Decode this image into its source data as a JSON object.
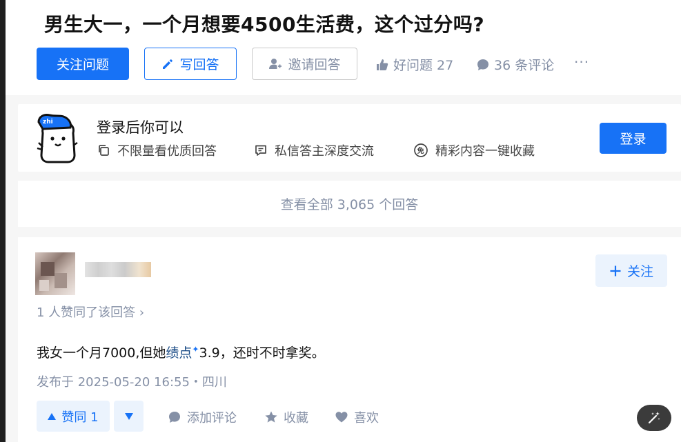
{
  "question": {
    "title": "男生大一，一个月想要4500生活费，这个过分吗?",
    "follow_label": "关注问题",
    "write_label": "写回答",
    "invite_label": "邀请回答",
    "good_question_label": "好问题 27",
    "comments_label": "36 条评论",
    "more_label": "···"
  },
  "login_prompt": {
    "title": "登录后你可以",
    "benefits": [
      "不限量看优质回答",
      "私信答主深度交流",
      "精彩内容一键收藏"
    ],
    "login_label": "登录"
  },
  "view_all_label": "查看全部 3,065 个回答",
  "answer": {
    "follow_label": "关注",
    "voters_label": "1 人赞同了该回答 ›",
    "text_before": "我女一个月7000,但她",
    "text_keyword": "绩点",
    "text_after": "3.9，还时不时拿奖。",
    "published": "发布于 2025-05-20 16:55・四川",
    "vote_label": "赞同 1",
    "comment_label": "添加评论",
    "favorite_label": "收藏",
    "like_label": "喜欢"
  },
  "colors": {
    "brand_blue": "#1772f6",
    "muted_gray": "#8590a6",
    "light_blue_bg": "#ebf3fd",
    "page_bg": "#f6f6f6"
  },
  "icons": [
    "pencil-icon",
    "invite-user-icon",
    "thumbs-up-icon",
    "comment-bubble-icon",
    "copy-icon",
    "message-icon",
    "vip-icon",
    "plus-icon",
    "triangle-up-icon",
    "triangle-down-icon",
    "star-icon",
    "heart-icon",
    "magic-wand-icon"
  ]
}
